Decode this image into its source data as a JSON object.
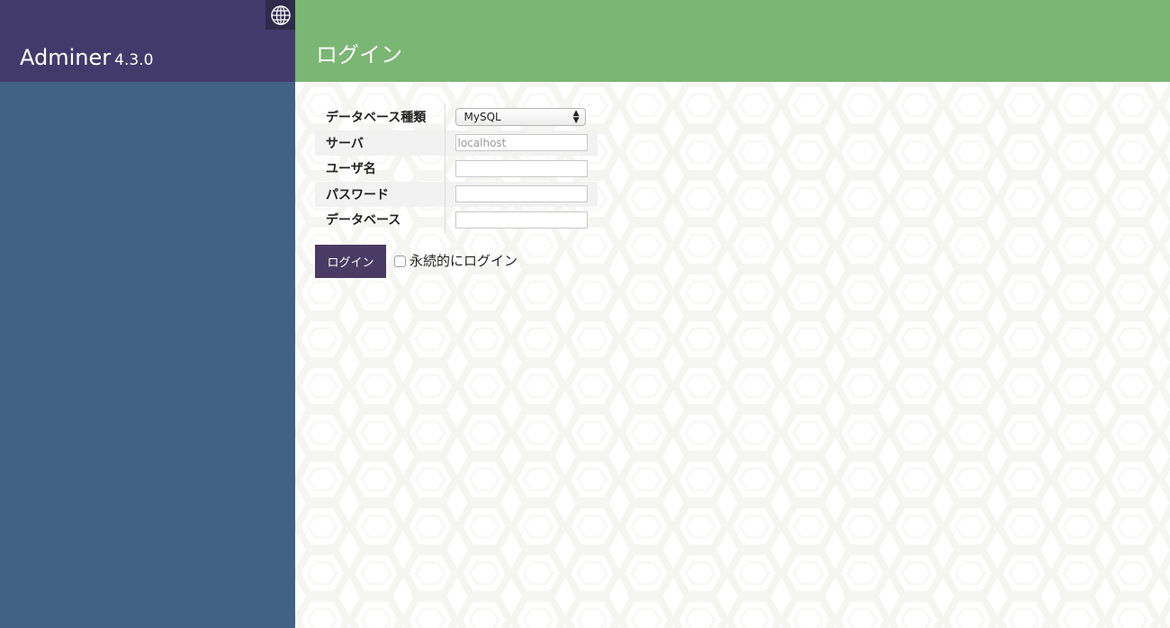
{
  "app": {
    "name": "Adminer",
    "version": "4.3.0"
  },
  "header": {
    "title": "ログイン"
  },
  "icons": {
    "language": "globe-icon",
    "select_arrows": "updown-arrows-icon"
  },
  "colors": {
    "sidebar": "#3f6285",
    "sidebar_header": "#433a6c",
    "header": "#7ab674",
    "login_button": "#4b3a63"
  },
  "form": {
    "rows": [
      {
        "label": "データベース種類",
        "type": "select",
        "value": "MySQL"
      },
      {
        "label": "サーバ",
        "type": "input",
        "value": "",
        "placeholder": "localhost"
      },
      {
        "label": "ユーザ名",
        "type": "input",
        "value": ""
      },
      {
        "label": "パスワード",
        "type": "input",
        "value": ""
      },
      {
        "label": "データベース",
        "type": "input",
        "value": ""
      }
    ],
    "submit_label": "ログイン",
    "remember_label": "永続的にログイン",
    "remember_checked": false
  }
}
